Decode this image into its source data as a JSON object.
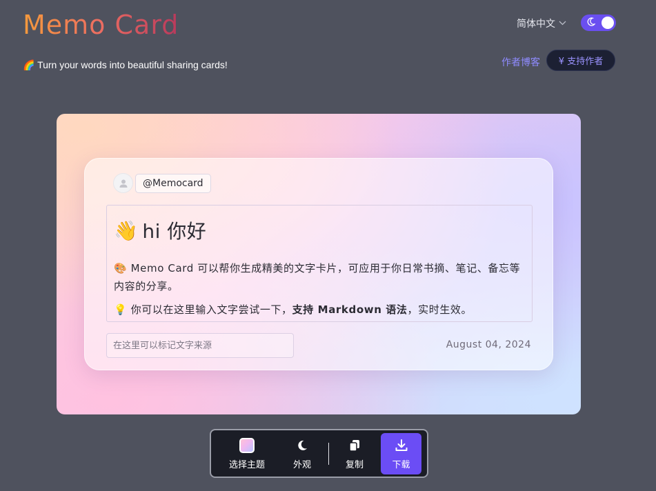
{
  "header": {
    "brand": "Memo Card",
    "tagline": "🌈 Turn your words into beautiful sharing cards!",
    "language_label": "简体中文",
    "blog_link": "作者博客",
    "support_button": "¥ 支持作者",
    "dark_mode": true
  },
  "card": {
    "handle": "@Memocard",
    "heading_emoji": "👋",
    "heading_text": "hi 你好",
    "para1": "🎨 Memo Card 可以帮你生成精美的文字卡片，可应用于你日常书摘、笔记、备忘等内容的分享。",
    "para2_prefix": "💡 你可以在这里输入文字尝试一下，",
    "para2_bold": "支持 Markdown 语法",
    "para2_suffix": "，实时生效。",
    "source_placeholder": "在这里可以标记文字来源",
    "date": "August 04, 2024"
  },
  "toolbar": {
    "theme_label": "选择主题",
    "appearance_label": "外观",
    "copy_label": "复制",
    "download_label": "下载"
  },
  "colors": {
    "page_bg": "#4f525e",
    "accent": "#6b4df5",
    "toolbar_bg": "#1b1d26"
  },
  "icons": [
    "chevron-down-icon",
    "moon-icon",
    "user-icon",
    "palette-swatch-icon",
    "copy-icon",
    "download-icon"
  ]
}
